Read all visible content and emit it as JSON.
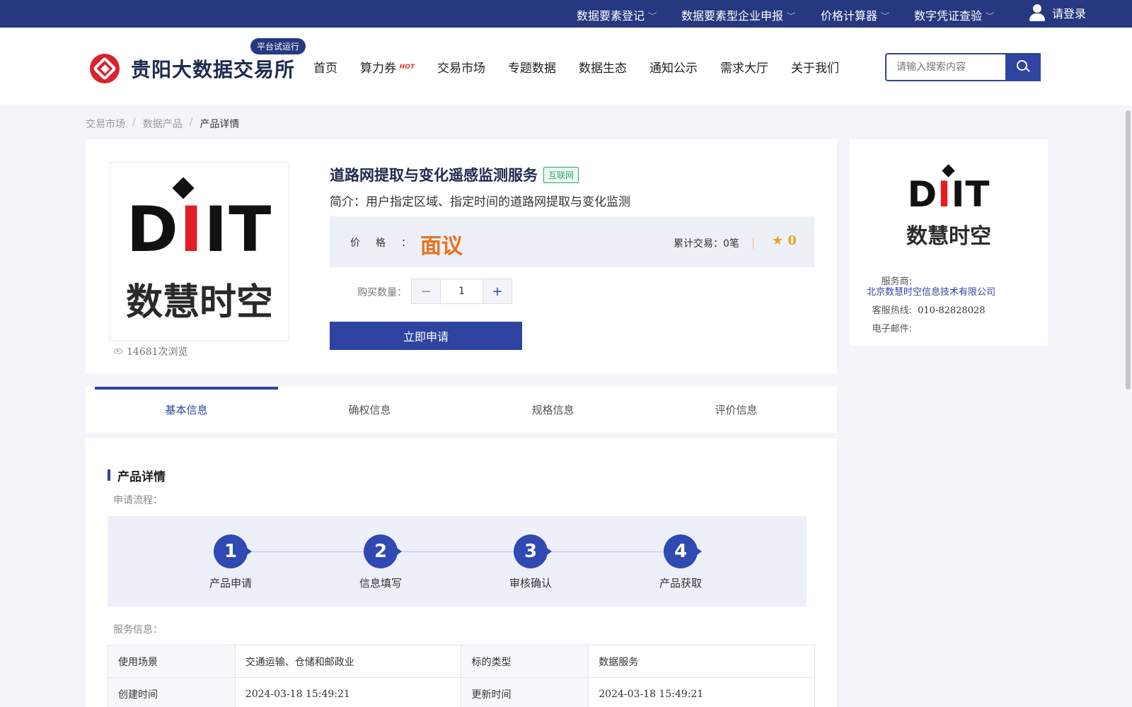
{
  "topbar": {
    "items": [
      "数据要素登记",
      "数据要素型企业申报",
      "价格计算器",
      "数字凭证查验"
    ],
    "login": "请登录"
  },
  "header": {
    "logo_text": "贵阳大数据交易所",
    "trial_badge": "平台试运行",
    "nav": [
      "首页",
      "算力券",
      "交易市场",
      "专题数据",
      "数据生态",
      "通知公示",
      "需求大厅",
      "关于我们"
    ],
    "hot_tag": "HOT",
    "search_placeholder": "请输入搜索内容"
  },
  "breadcrumb": [
    "交易市场",
    "数据产品",
    "产品详情"
  ],
  "product": {
    "logo_letters_1": "D",
    "logo_letters_2": "I",
    "logo_letters_3": "I",
    "logo_letters_4": "T",
    "logo_cn": "数慧时空",
    "views": "14681次浏览",
    "title": "道路网提取与变化遥感监测服务",
    "tag": "互联网",
    "intro": "简介：用户指定区域、指定时间的道路网提取与变化监测",
    "price_label": "价格：",
    "price_value": "面议",
    "trade_label": "累计交易：",
    "trade_value": "0笔",
    "rating": "0",
    "qty_label": "购买数量：",
    "qty_value": "1",
    "apply_button": "立即申请"
  },
  "provider": {
    "provider_label": "服务商:",
    "provider_value": "北京数慧时空信息技术有限公司",
    "hotline_label": "客服热线:",
    "hotline_value": "010-82828028",
    "email_label": "电子邮件:",
    "email_value": ""
  },
  "tabs": [
    "基本信息",
    "确权信息",
    "规格信息",
    "评价信息"
  ],
  "details": {
    "section_title": "产品详情",
    "process_label": "申请流程：",
    "steps": [
      {
        "num": "1",
        "label": "产品申请"
      },
      {
        "num": "2",
        "label": "信息填写"
      },
      {
        "num": "3",
        "label": "审核确认"
      },
      {
        "num": "4",
        "label": "产品获取"
      }
    ],
    "service_label": "服务信息：",
    "table": [
      [
        "使用场景",
        "交通运输、仓储和邮政业",
        "标的类型",
        "数据服务"
      ],
      [
        "创建时间",
        "2024-03-18 15:49:21",
        "更新时间",
        "2024-03-18 15:49:21"
      ]
    ]
  },
  "colors": {
    "primary": "#2f44a0",
    "topbar": "#26387f",
    "price": "#e8721d",
    "rating": "#f0a020",
    "logo_red": "#d9232d"
  }
}
